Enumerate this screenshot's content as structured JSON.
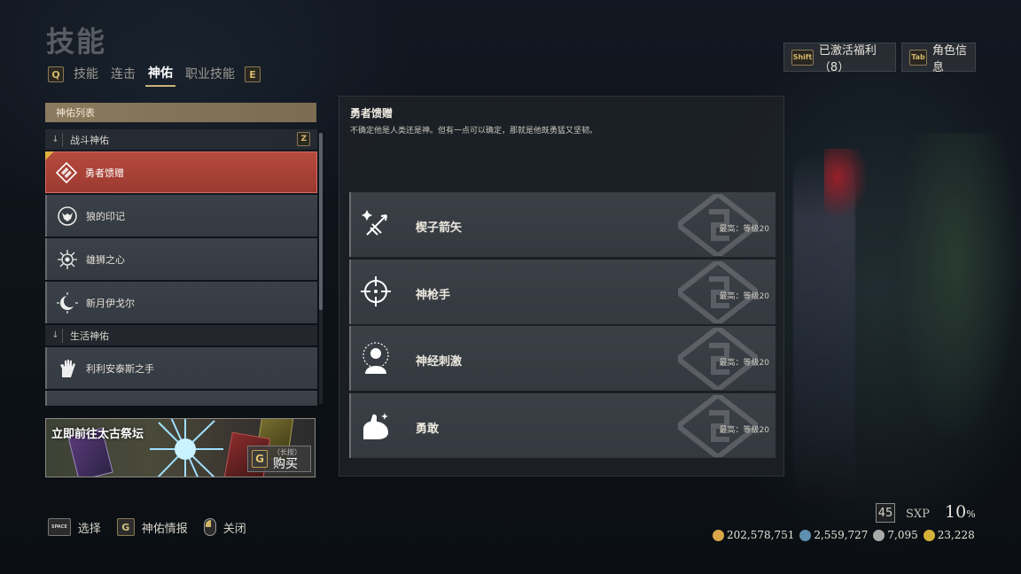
{
  "screen": {
    "title": "技能",
    "tab_prev_key": "Q",
    "tab_next_key": "E",
    "tabs": [
      {
        "label": "技能",
        "active": false
      },
      {
        "label": "连击",
        "active": false
      },
      {
        "label": "神佑",
        "active": true
      },
      {
        "label": "职业技能",
        "active": false
      }
    ]
  },
  "top_buttons": {
    "benefits_key": "Shift",
    "benefits_label": "已激活福利（8）",
    "character_key": "Tab",
    "character_label": "角色信息"
  },
  "blessing_list": {
    "header": "神佑列表",
    "sections": [
      {
        "label": "战斗神佑",
        "key": "Z"
      },
      {
        "label": "生活神佑"
      }
    ],
    "combat_items": [
      {
        "label": "勇者馈赠",
        "icon": "hero-gift-icon",
        "selected": true
      },
      {
        "label": "狼的印记",
        "icon": "wolf-mark-icon",
        "selected": false
      },
      {
        "label": "雄狮之心",
        "icon": "lion-heart-icon",
        "selected": false
      },
      {
        "label": "新月伊戈尔",
        "icon": "crescent-moon-icon",
        "selected": false
      }
    ],
    "life_items": [
      {
        "label": "利利安泰斯之手",
        "icon": "hand-icon",
        "selected": false
      }
    ]
  },
  "promo": {
    "title": "立即前往太古祭坛",
    "buy_key": "G",
    "buy_hint": "（长按）",
    "buy_label": "购买"
  },
  "detail": {
    "name": "勇者馈赠",
    "description": "不确定他是人类还是神。但有一点可以确定，那就是他既勇猛又坚韧。",
    "skills": [
      {
        "name": "楔子箭矢",
        "level": "最高：等级20",
        "icon": "wedge-arrow-icon"
      },
      {
        "name": "神枪手",
        "level": "最高：等级20",
        "icon": "crosshair-icon"
      },
      {
        "name": "神经刺激",
        "level": "最高：等级20",
        "icon": "nerve-stimulus-icon"
      },
      {
        "name": "勇敢",
        "level": "最高：等级20",
        "icon": "flexed-arm-icon"
      }
    ]
  },
  "bottom_bar": {
    "select_key": "SPACE",
    "select_label": "选择",
    "info_key": "G",
    "info_label": "神佑情报",
    "close_label": "关闭"
  },
  "status": {
    "level": "45",
    "sxp_label": "SXP",
    "sxp_percent": "10",
    "sxp_unit": "%",
    "currencies": [
      {
        "value": "202,578,751",
        "icon": "gold-coin-icon",
        "color": "#d9a64a"
      },
      {
        "value": "2,559,727",
        "icon": "blue-gem-icon",
        "color": "#5d8fb0"
      },
      {
        "value": "7,095",
        "icon": "silver-gem-icon",
        "color": "#a9a9a9"
      },
      {
        "value": "23,228",
        "icon": "gold-flower-icon",
        "color": "#d4b03a"
      }
    ]
  },
  "colors": {
    "selected_item": "#b54a3e",
    "accent_gold": "#c9b27a",
    "panel_header": "#8a7a5e"
  }
}
